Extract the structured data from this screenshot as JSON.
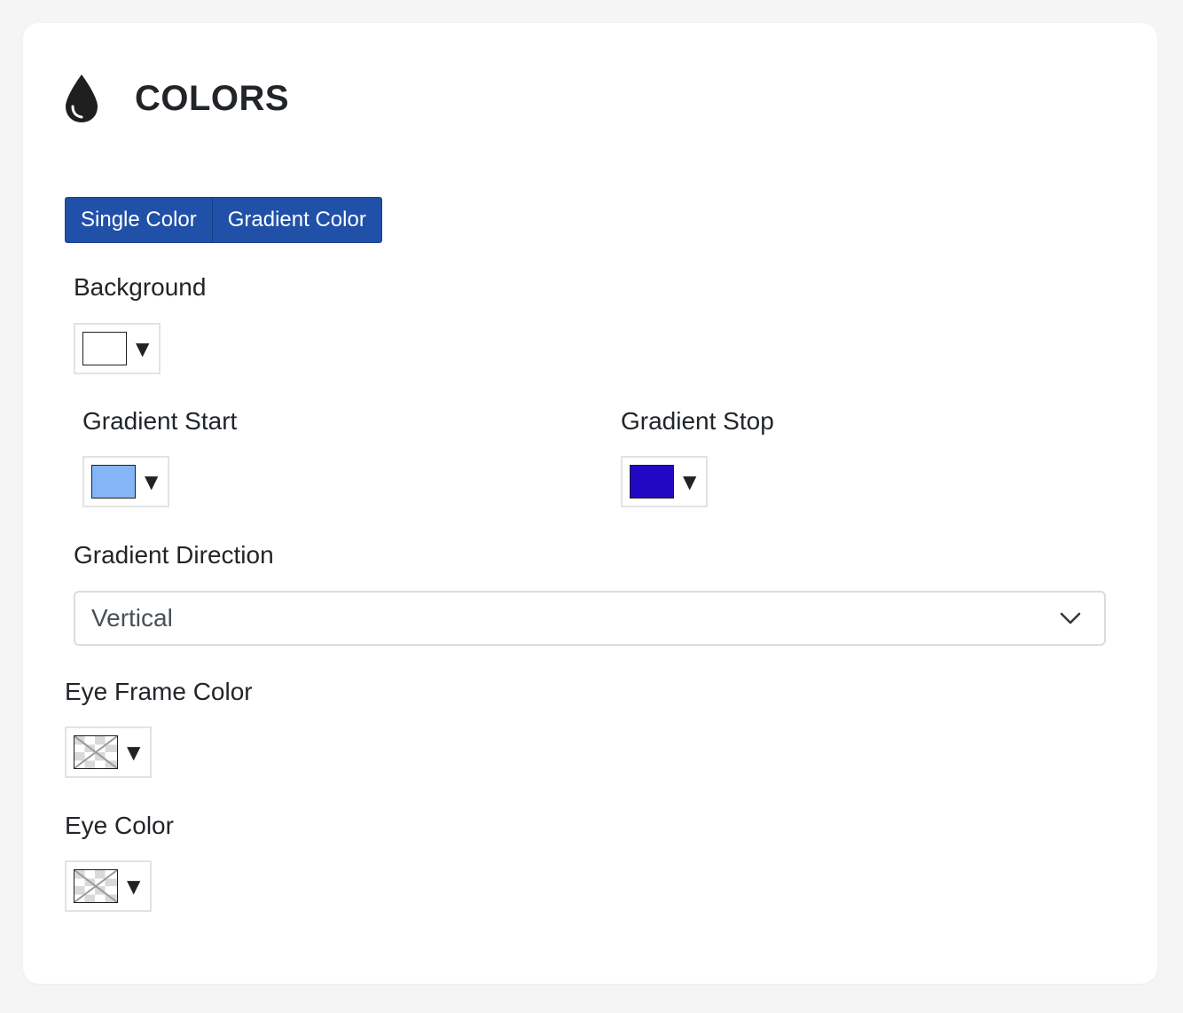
{
  "header": {
    "icon": "drop-icon",
    "title": "COLORS"
  },
  "mode_toggle": {
    "single_label": "Single Color",
    "gradient_label": "Gradient Color",
    "color": "#2150a8"
  },
  "background": {
    "label": "Background",
    "color": "#ffffff",
    "caret": "▼"
  },
  "gradient_start": {
    "label": "Gradient Start",
    "color": "#84b5f7",
    "caret": "▼"
  },
  "gradient_stop": {
    "label": "Gradient Stop",
    "color": "#2208c4",
    "caret": "▼"
  },
  "gradient_direction": {
    "label": "Gradient Direction",
    "value": "Vertical",
    "icon": "chevron-down-icon"
  },
  "eye_frame_color": {
    "label": "Eye Frame Color",
    "color": "none",
    "caret": "▼"
  },
  "eye_color": {
    "label": "Eye Color",
    "color": "none",
    "caret": "▼"
  }
}
